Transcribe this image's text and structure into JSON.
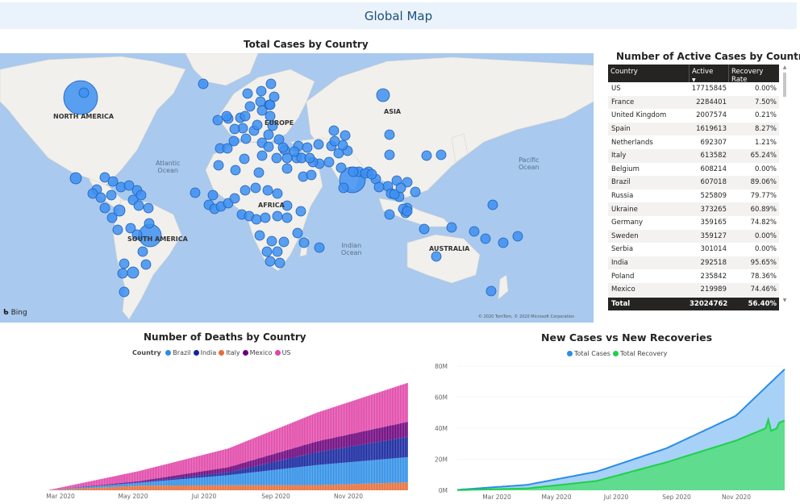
{
  "page": {
    "title": "Global Map"
  },
  "map": {
    "title": "Total Cases by Country",
    "continent_labels": [
      "NORTH AMERICA",
      "ASIA",
      "EUROPE",
      "AFRICA",
      "SOUTH AMERICA",
      "AUSTRALIA"
    ],
    "ocean_labels": [
      "Atlantic\nOcean",
      "Pacific\nOcean",
      "Indian\nOcean"
    ],
    "attribution": "Bing",
    "copyright": "© 2020 TomTom, © 2020 Microsoft Corporation",
    "bubble_color": "#3d8ff2"
  },
  "table": {
    "title": "Number of Active Cases by Country",
    "headers": [
      "Country",
      "Active",
      "Recovery Rate"
    ],
    "rows": [
      [
        "US",
        "17715845",
        "0.00%"
      ],
      [
        "France",
        "2284401",
        "7.50%"
      ],
      [
        "United Kingdom",
        "2007574",
        "0.21%"
      ],
      [
        "Spain",
        "1619613",
        "8.27%"
      ],
      [
        "Netherlands",
        "692307",
        "1.21%"
      ],
      [
        "Italy",
        "613582",
        "65.24%"
      ],
      [
        "Belgium",
        "608214",
        "0.00%"
      ],
      [
        "Brazil",
        "607018",
        "89.06%"
      ],
      [
        "Russia",
        "525809",
        "79.77%"
      ],
      [
        "Ukraine",
        "373265",
        "60.89%"
      ],
      [
        "Germany",
        "359165",
        "74.82%"
      ],
      [
        "Sweden",
        "359127",
        "0.00%"
      ],
      [
        "Serbia",
        "301014",
        "0.00%"
      ],
      [
        "India",
        "292518",
        "95.65%"
      ],
      [
        "Poland",
        "235842",
        "78.36%"
      ],
      [
        "Mexico",
        "219989",
        "74.46%"
      ]
    ],
    "total": [
      "Total",
      "32024762",
      "56.40%"
    ]
  },
  "chart_data": [
    {
      "type": "bar",
      "title": "Number of Deaths by Country",
      "legend_title": "Country",
      "categories": [
        "Mar 2020",
        "May 2020",
        "Jul 2020",
        "Sep 2020",
        "Nov 2020"
      ],
      "series": [
        {
          "name": "Brazil",
          "color": "#2c8de6",
          "values": [
            0,
            20000,
            70000,
            140000,
            175000
          ]
        },
        {
          "name": "India",
          "color": "#12239e",
          "values": [
            0,
            3000,
            20000,
            90000,
            140000
          ]
        },
        {
          "name": "Italy",
          "color": "#e66c37",
          "values": [
            2000,
            32000,
            35000,
            36000,
            55000
          ]
        },
        {
          "name": "Mexico",
          "color": "#6b007b",
          "values": [
            0,
            8000,
            35000,
            75000,
            105000
          ]
        },
        {
          "name": "US",
          "color": "#e044a7",
          "values": [
            500,
            70000,
            130000,
            200000,
            270000
          ]
        }
      ]
    },
    {
      "type": "area",
      "title": "New Cases vs New Recoveries",
      "x": [
        "Mar 2020",
        "May 2020",
        "Jul 2020",
        "Sep 2020",
        "Nov 2020"
      ],
      "y_ticks": [
        "0M",
        "20M",
        "40M",
        "60M",
        "80M"
      ],
      "ylim": [
        0,
        80
      ],
      "series": [
        {
          "name": "Total Cases",
          "color": "#2c8de6",
          "values": [
            0.3,
            3.5,
            12,
            27,
            48
          ]
        },
        {
          "name": "Total Recovery",
          "color": "#20d04a",
          "values": [
            0.1,
            1.2,
            6,
            18,
            32
          ]
        }
      ],
      "final_total_cases": 78,
      "final_total_recovery": 45
    }
  ]
}
